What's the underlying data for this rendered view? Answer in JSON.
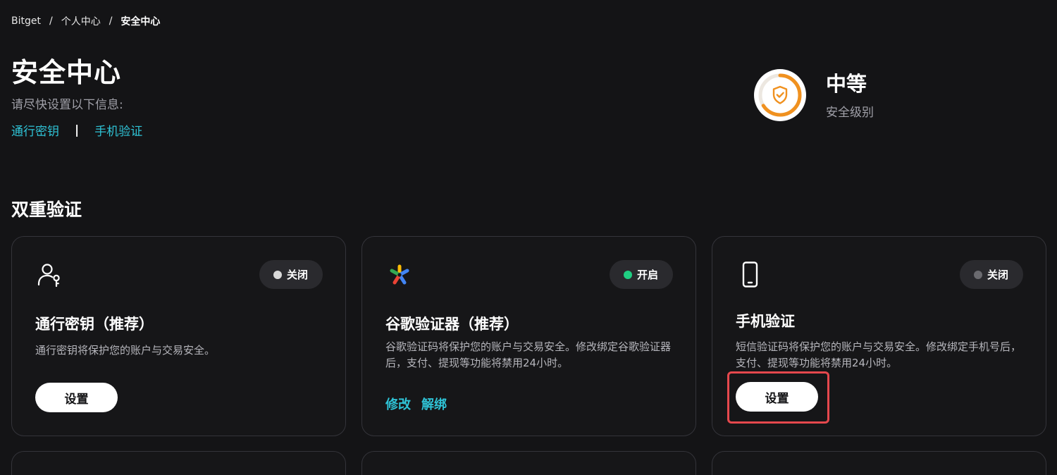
{
  "breadcrumb": {
    "items": [
      "Bitget",
      "个人中心",
      "安全中心"
    ],
    "separator": "/"
  },
  "header": {
    "title": "安全中心",
    "subtitle": "请尽快设置以下信息:",
    "quick_links": [
      "通行密钥",
      "手机验证"
    ],
    "link_divider": "|"
  },
  "security_level": {
    "value": "中等",
    "label": "安全级别",
    "gauge_fraction": 0.66,
    "gauge_color": "#f0911f",
    "icon": "shield-check-icon"
  },
  "section": {
    "title": "双重验证"
  },
  "colors": {
    "accent": "#2fc3d6",
    "status_on": "#1fcf82",
    "status_off_light": "#d9d9d9",
    "status_off_dark": "#6b6b70",
    "highlight": "#e5484d"
  },
  "cards": [
    {
      "icon": "passkey-user-key-icon",
      "status": "关闭",
      "title": "通行密钥（推荐）",
      "description": "通行密钥将保护您的账户与交易安全。",
      "button": "设置"
    },
    {
      "icon": "google-authenticator-icon",
      "status": "开启",
      "title": "谷歌验证器（推荐）",
      "description": "谷歌验证码将保护您的账户与交易安全。修改绑定谷歌验证器后，支付、提现等功能将禁用24小时。",
      "actions": [
        "修改",
        "解绑"
      ]
    },
    {
      "icon": "smartphone-icon",
      "status": "关闭",
      "title": "手机验证",
      "description": "短信验证码将保护您的账户与交易安全。修改绑定手机号后，支付、提现等功能将禁用24小时。",
      "button": "设置"
    }
  ]
}
